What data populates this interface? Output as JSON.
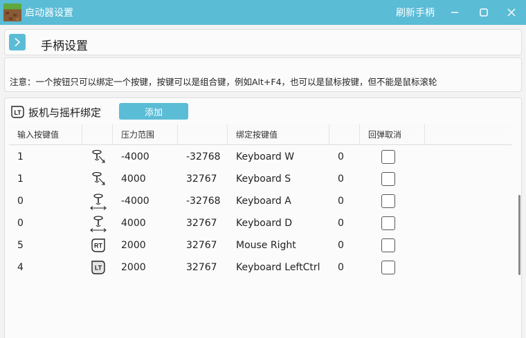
{
  "window": {
    "title": "启动器设置",
    "refresh_label": "刷新手柄",
    "icons": {
      "app": "grass-block-icon",
      "minimize": "minimize-icon",
      "maximize": "maximize-icon",
      "close": "close-icon"
    }
  },
  "header": {
    "title": "手柄设置",
    "expand_icon": "chevron-right-icon"
  },
  "note": {
    "text": "注意：一个按钮只可以绑定一个按键，按键可以是组合键，例如Alt+F4，也可以是鼠标按键，但不能是鼠标滚轮"
  },
  "bindings": {
    "title": "扳机与摇杆绑定",
    "title_icon": "lt-trigger-icon",
    "add_label": "添加",
    "columns": [
      "输入按键值",
      "",
      "压力范围",
      "",
      "绑定按键值",
      "",
      "回弹取消"
    ],
    "rows": [
      {
        "input": "1",
        "icon": "joystick-up-left-icon",
        "range_start": "-4000",
        "range_end": "-32768",
        "key": "Keyboard W",
        "value": "0",
        "rebound_cancel": false
      },
      {
        "input": "1",
        "icon": "joystick-down-right-icon",
        "range_start": "4000",
        "range_end": "32767",
        "key": "Keyboard S",
        "value": "0",
        "rebound_cancel": false
      },
      {
        "input": "0",
        "icon": "joystick-left-icon",
        "range_start": "-4000",
        "range_end": "-32768",
        "key": "Keyboard A",
        "value": "0",
        "rebound_cancel": false
      },
      {
        "input": "0",
        "icon": "joystick-right-icon",
        "range_start": "4000",
        "range_end": "32767",
        "key": "Keyboard D",
        "value": "0",
        "rebound_cancel": false
      },
      {
        "input": "5",
        "icon": "rt-trigger-icon",
        "range_start": "2000",
        "range_end": "32767",
        "key": "Mouse Right",
        "value": "0",
        "rebound_cancel": false
      },
      {
        "input": "4",
        "icon": "lt-trigger-icon",
        "range_start": "2000",
        "range_end": "32767",
        "key": "Keyboard LeftCtrl",
        "value": "0",
        "rebound_cancel": false
      }
    ]
  },
  "badges": {
    "rt": "RT",
    "lt": "LT"
  },
  "colors": {
    "accent": "#5bbcd6",
    "background": "#f3f3f3"
  }
}
